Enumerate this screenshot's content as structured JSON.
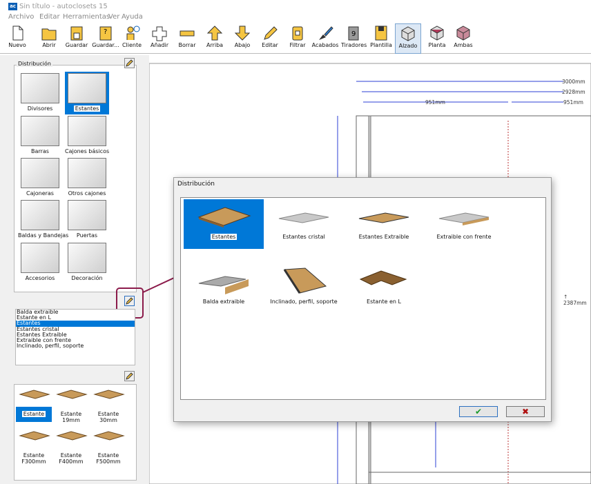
{
  "window": {
    "title": "Sin título - autoclosets 15",
    "icon": "ac-app-icon"
  },
  "menu": [
    "Archivo",
    "Editar",
    "Herramientas",
    "Ver",
    "Ayuda"
  ],
  "toolbar": [
    {
      "label": "Nuevo",
      "icon": "new-file-icon"
    },
    {
      "label": "Abrir",
      "icon": "open-folder-icon"
    },
    {
      "label": "Guardar",
      "icon": "save-icon"
    },
    {
      "label": "Guardar...",
      "icon": "save-as-icon"
    },
    {
      "label": "Cliente",
      "icon": "client-icon"
    },
    {
      "label": "Añadir",
      "icon": "add-icon"
    },
    {
      "label": "Borrar",
      "icon": "delete-icon"
    },
    {
      "label": "Arriba",
      "icon": "arrow-up-icon"
    },
    {
      "label": "Abajo",
      "icon": "arrow-down-icon"
    },
    {
      "label": "Editar",
      "icon": "edit-pencil-icon"
    },
    {
      "label": "Filtrar",
      "icon": "filter-icon"
    },
    {
      "label": "Acabados",
      "icon": "paint-brush-icon"
    },
    {
      "label": "Tiradores",
      "icon": "handle-icon"
    },
    {
      "label": "Plantilla",
      "icon": "template-icon"
    },
    {
      "label": "Alzado",
      "icon": "elevation-cube-icon",
      "active": true
    },
    {
      "label": "Planta",
      "icon": "plan-cube-icon"
    },
    {
      "label": "Ambas",
      "icon": "both-cube-icon"
    }
  ],
  "left": {
    "group_title": "Distribución",
    "categories": [
      "Divisores",
      "Estantes",
      "Barras",
      "Cajones básicos",
      "Cajoneras",
      "Otros cajones",
      "Baldas y Bandejas",
      "Puertas",
      "Accesorios",
      "Decoración"
    ],
    "selected_category": "Estantes",
    "list": [
      "Balda extraible",
      "Estante en L",
      "Estantes",
      "Estantes cristal",
      "Estantes Extraible",
      "Extraible con frente",
      "Inclinado, perfil, soporte"
    ],
    "selected_list": "Estantes",
    "shelves": [
      {
        "l1": "Estante",
        "l2": ""
      },
      {
        "l1": "Estante",
        "l2": "19mm"
      },
      {
        "l1": "Estante",
        "l2": "30mm"
      },
      {
        "l1": "Estante",
        "l2": "F300mm"
      },
      {
        "l1": "Estante",
        "l2": "F400mm"
      },
      {
        "l1": "Estante",
        "l2": "F500mm"
      }
    ]
  },
  "canvas": {
    "dims": [
      "3000mm",
      "2928mm",
      "951mm",
      "951mm"
    ],
    "height_label": "↑ 2387mm"
  },
  "dialog": {
    "title": "Distribución",
    "items": [
      "Estantes",
      "Estantes cristal",
      "Estantes Extraible",
      "Extraible con frente",
      "Balda extraible",
      "Inclinado, perfil, soporte",
      "Estante en L"
    ],
    "selected": "Estantes",
    "ok": "✔",
    "cancel": "✖"
  },
  "colors": {
    "selection": "#0078d7",
    "callout": "#8b1a4a",
    "dim_line": "#2b3fd6",
    "wood": "#c89a5a"
  }
}
